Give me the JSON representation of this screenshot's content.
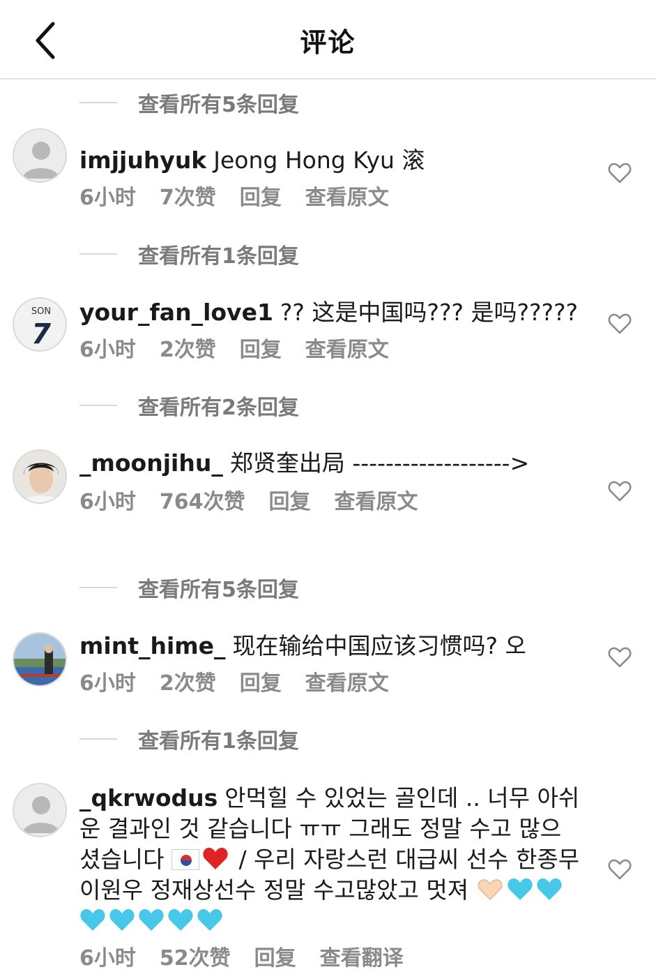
{
  "header": {
    "title": "评论"
  },
  "comments": [
    {
      "replies_above": "查看所有5条回复",
      "username": "imjjuhyuk",
      "text": "Jeong Hong Kyu 滚",
      "time": "6小时",
      "likes": "7次赞",
      "reply": "回复",
      "translate": "查看原文",
      "avatar": "default-avatar"
    },
    {
      "replies_above": "查看所有1条回复",
      "username": "your_fan_love1",
      "text": "?? 这是中国吗??? 是吗?????",
      "time": "6小时",
      "likes": "2次赞",
      "reply": "回复",
      "translate": "查看原文",
      "avatar": "jersey-son-7",
      "avatar_text": {
        "name": "SON",
        "number": "7"
      }
    },
    {
      "replies_above": "查看所有2条回复",
      "username": "_moonjihu_",
      "text": "郑贤奎出局 ------------------->",
      "time": "6小时",
      "likes": "764次赞",
      "reply": "回复",
      "translate": "查看原文",
      "avatar": "portrait-photo"
    },
    {
      "replies_above": "查看所有5条回复",
      "username": "mint_hime_",
      "text": "现在输给中国应该习惯吗? 오",
      "time": "6小时",
      "likes": "2次赞",
      "reply": "回复",
      "translate": "查看原文",
      "avatar": "stadium-photo"
    },
    {
      "replies_above": "查看所有1条回复",
      "username": "_qkrwodus",
      "text_part1": "안먹힐 수 있었는 골인데 .. 너무 아쉬운 결과인 것 같습니다 ㅠㅠ 그래도 정말 수고 많으셨습니다",
      "text_part2": "/ 우리 자랑스런 대급씨 선수 한종무 이원우 정재상선수 정말 수고많았고 멋져",
      "time": "6小时",
      "likes": "52次赞",
      "reply": "回复",
      "translate": "查看翻译",
      "avatar": "default-avatar"
    }
  ],
  "colors": {
    "heart_blue": "#48c8e8",
    "heart_red": "#e02424",
    "meta_gray": "#8a8a8a"
  }
}
